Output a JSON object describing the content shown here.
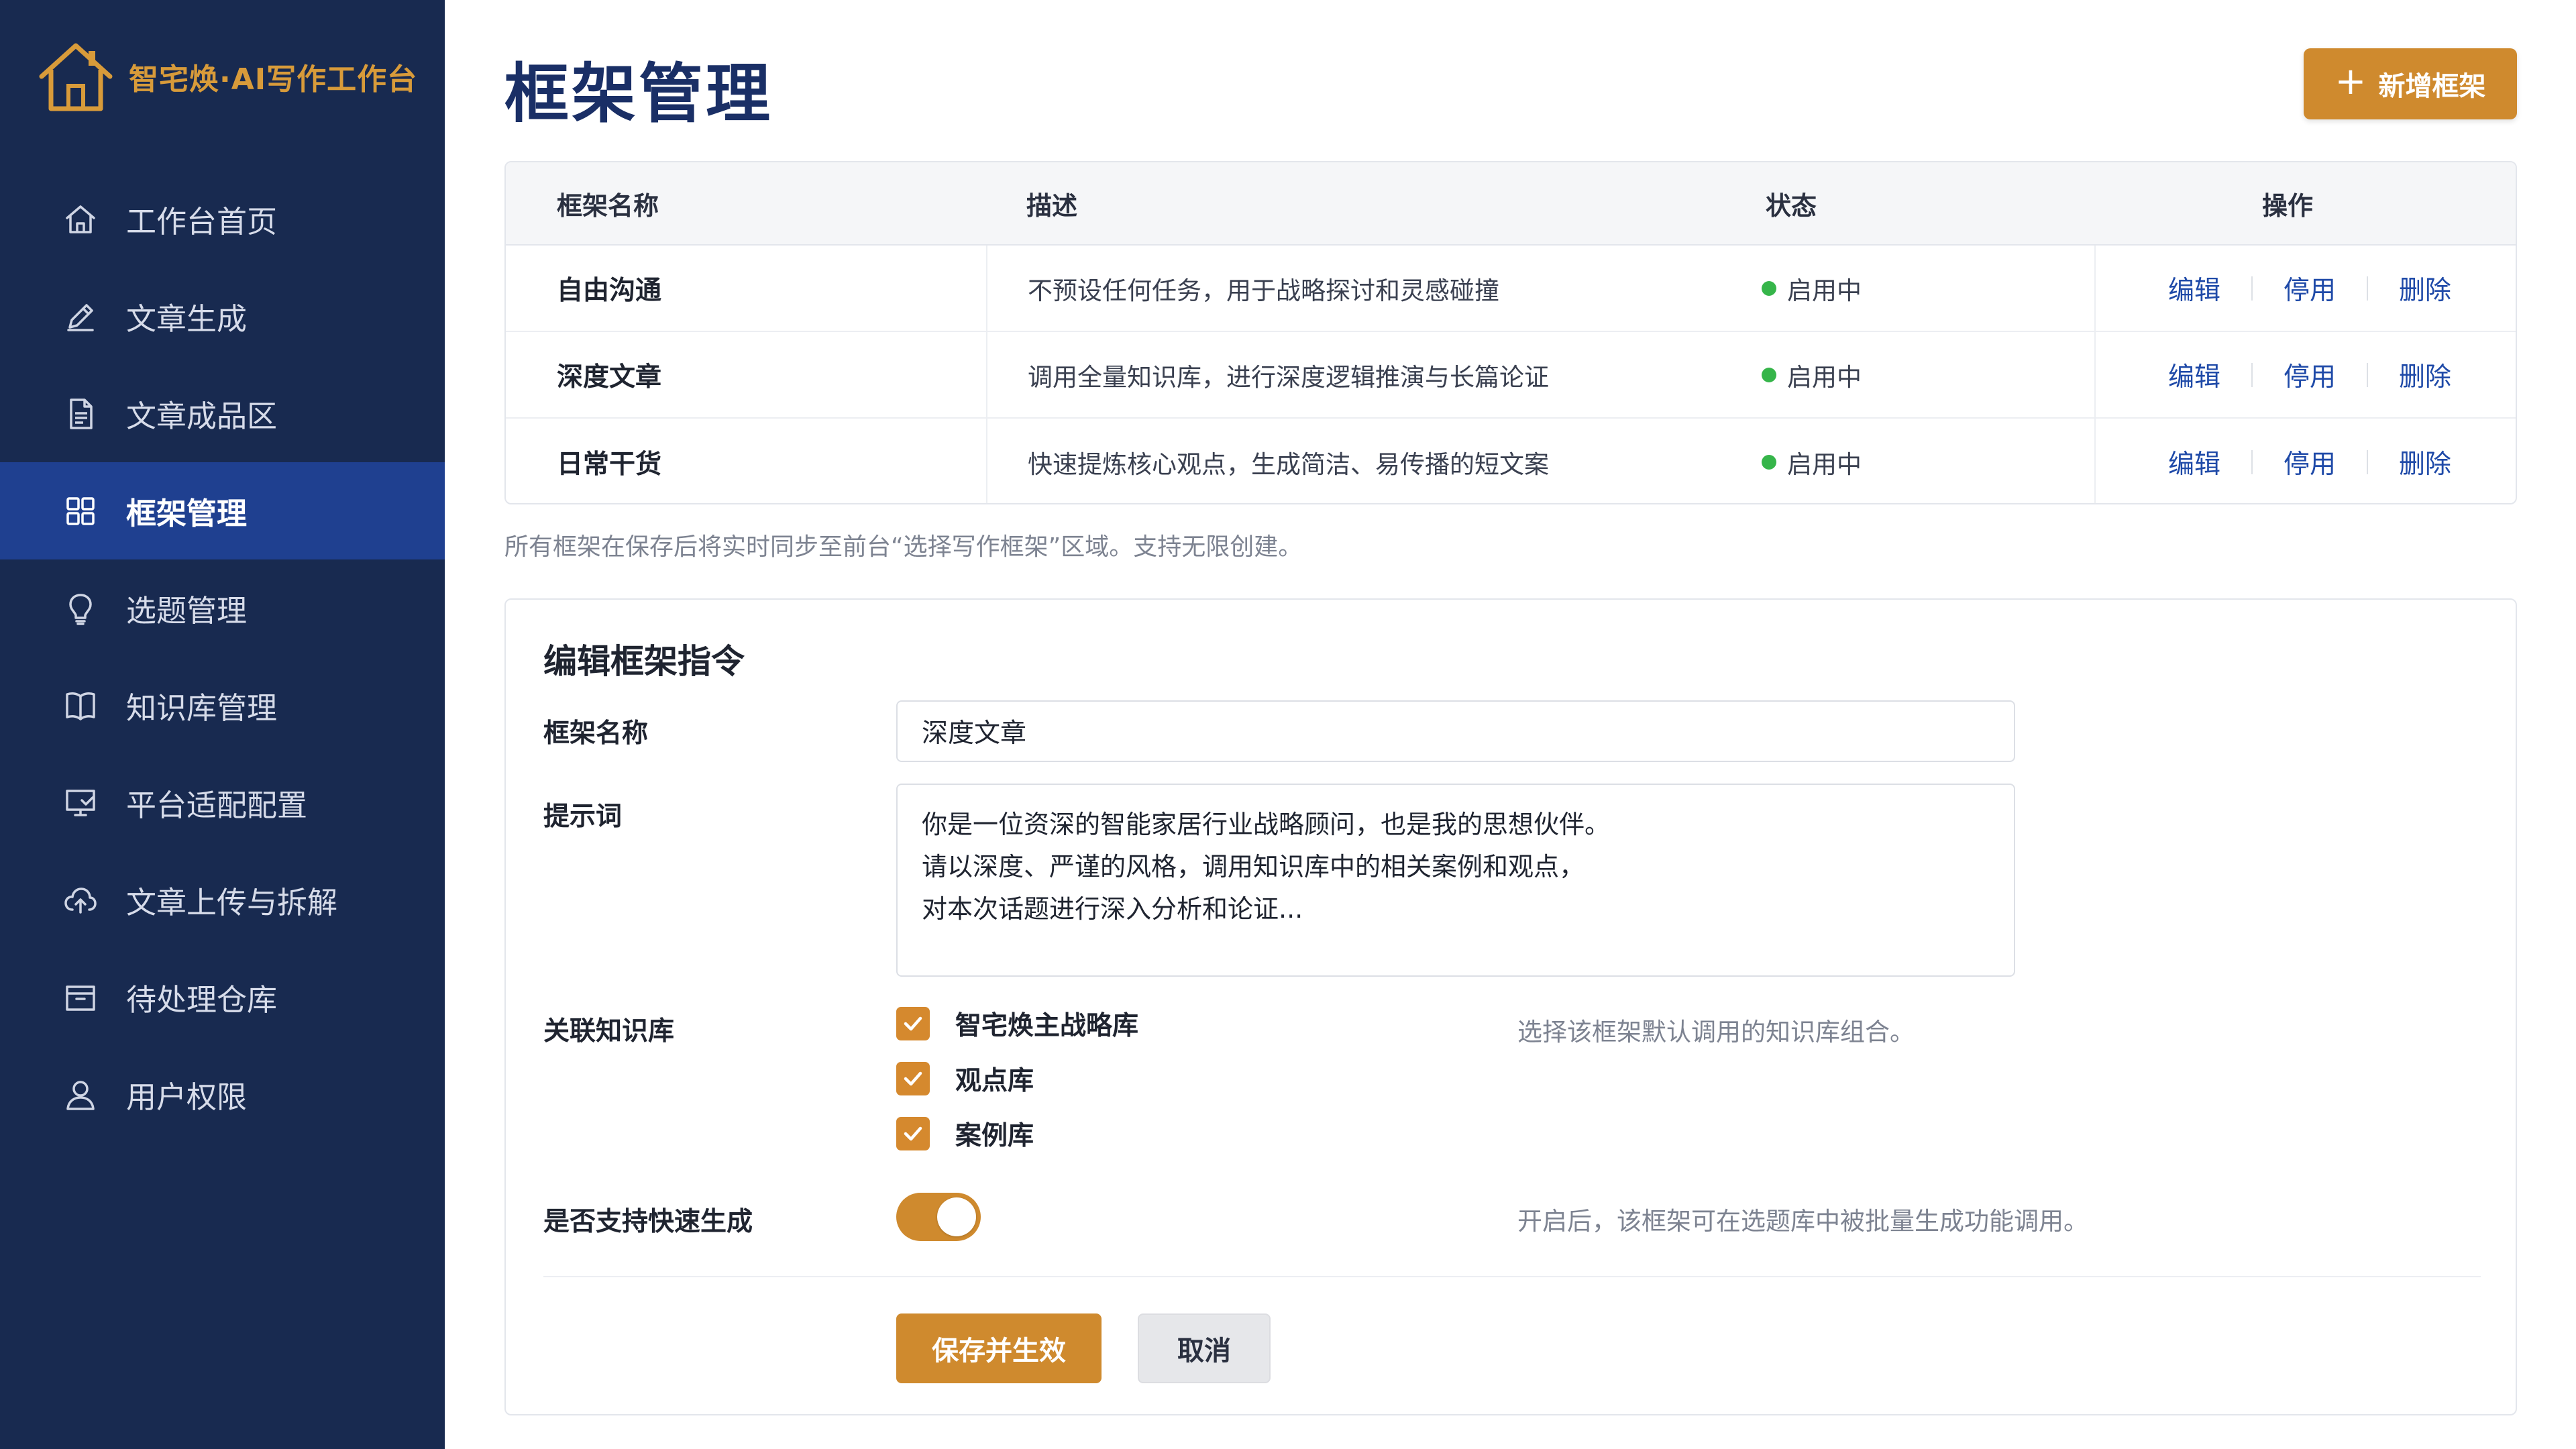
{
  "brand": {
    "title": "智宅焕·AI写作工作台",
    "logo_icon": "house-logo-icon",
    "color": "#d89b3a"
  },
  "sidebar": {
    "items": [
      {
        "label": "工作台首页",
        "icon": "home-icon",
        "active": false
      },
      {
        "label": "文章生成",
        "icon": "pencil-icon",
        "active": false
      },
      {
        "label": "文章成品区",
        "icon": "document-icon",
        "active": false
      },
      {
        "label": "框架管理",
        "icon": "grid-icon",
        "active": true
      },
      {
        "label": "选题管理",
        "icon": "lightbulb-icon",
        "active": false
      },
      {
        "label": "知识库管理",
        "icon": "book-icon",
        "active": false
      },
      {
        "label": "平台适配配置",
        "icon": "monitor-icon",
        "active": false
      },
      {
        "label": "文章上传与拆解",
        "icon": "cloud-upload-icon",
        "active": false
      },
      {
        "label": "待处理仓库",
        "icon": "inbox-icon",
        "active": false
      },
      {
        "label": "用户权限",
        "icon": "user-icon",
        "active": false
      }
    ]
  },
  "header": {
    "title": "框架管理",
    "add_button": "新增框架",
    "add_icon": "plus-icon"
  },
  "table": {
    "columns": [
      "框架名称",
      "描述",
      "状态",
      "操作"
    ],
    "rows": [
      {
        "name": "自由沟通",
        "desc": "不预设任何任务，用于战略探讨和灵感碰撞",
        "status": "启用中",
        "ops": [
          "编辑",
          "停用",
          "删除"
        ]
      },
      {
        "name": "深度文章",
        "desc": "调用全量知识库，进行深度逻辑推演与长篇论证",
        "status": "启用中",
        "ops": [
          "编辑",
          "停用",
          "删除"
        ]
      },
      {
        "name": "日常干货",
        "desc": "快速提炼核心观点，生成简洁、易传播的短文案",
        "status": "启用中",
        "ops": [
          "编辑",
          "停用",
          "删除"
        ]
      }
    ],
    "status_color": "#36b54a"
  },
  "note": "所有框架在保存后将实时同步至前台“选择写作框架”区域。支持无限创建。",
  "editor": {
    "title": "编辑框架指令",
    "name_label": "框架名称",
    "name_value": "深度文章",
    "prompt_label": "提示词",
    "prompt_lines": [
      "你是一位资深的智能家居行业战略顾问，也是我的思想伙伴。",
      "请以深度、严谨的风格，调用知识库中的相关案例和观点，",
      "对本次话题进行深入分析和论证..."
    ],
    "kb_label": "关联知识库",
    "kb_options": [
      {
        "label": "智宅焕主战略库",
        "checked": true
      },
      {
        "label": "观点库",
        "checked": true
      },
      {
        "label": "案例库",
        "checked": true
      }
    ],
    "kb_hint": "选择该框架默认调用的知识库组合。",
    "fast_label": "是否支持快速生成",
    "fast_enabled": true,
    "fast_hint": "开启后，该框架可在选题库中被批量生成功能调用。",
    "save_label": "保存并生效",
    "cancel_label": "取消"
  },
  "colors": {
    "sidebar_bg": "#182a50",
    "active_bg": "#1f4090",
    "accent": "#cf8a2e",
    "title": "#1a2f66",
    "link": "#1f4aa8"
  }
}
